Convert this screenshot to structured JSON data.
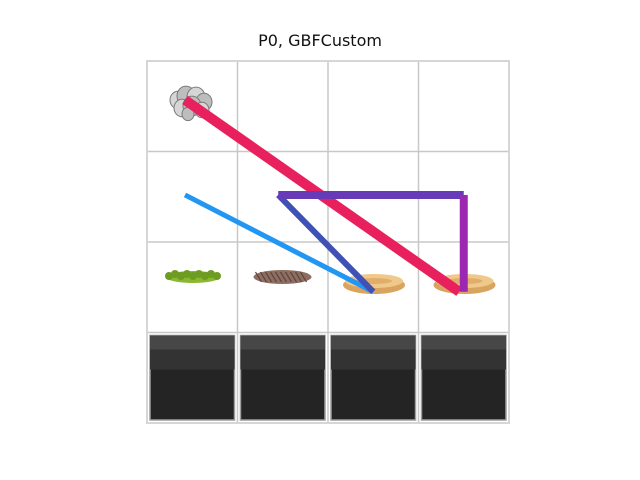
{
  "title": "P0, GBFCustom",
  "grid": {
    "rows": 4,
    "cols": 4,
    "line_color": "#c8c8c8",
    "border_color": "#d6d6d6"
  },
  "cells": [
    {
      "row": 0,
      "col": 0,
      "item": "lettuce"
    },
    {
      "row": 2,
      "col": 0,
      "item": "cucumber"
    },
    {
      "row": 2,
      "col": 1,
      "item": "patty"
    },
    {
      "row": 2,
      "col": 2,
      "item": "bun"
    },
    {
      "row": 2,
      "col": 3,
      "item": "bun"
    },
    {
      "row": 3,
      "col": 0,
      "item": "counter"
    },
    {
      "row": 3,
      "col": 1,
      "item": "counter"
    },
    {
      "row": 3,
      "col": 2,
      "item": "counter"
    },
    {
      "row": 3,
      "col": 3,
      "item": "counter"
    }
  ],
  "paths": [
    {
      "name": "path-red",
      "color": "#e8215e",
      "width": 10,
      "points": [
        [
          0.42,
          0.43
        ],
        [
          3.45,
          2.55
        ]
      ]
    },
    {
      "name": "path-blue",
      "color": "#2196f3",
      "width": 5,
      "points": [
        [
          0.42,
          1.48
        ],
        [
          2.5,
          2.55
        ]
      ]
    },
    {
      "name": "path-indigo",
      "color": "#3f51b5",
      "width": 6,
      "points": [
        [
          1.45,
          1.48
        ],
        [
          2.5,
          2.55
        ]
      ]
    },
    {
      "name": "path-deep-purple",
      "color": "#673ab7",
      "width": 8,
      "points": [
        [
          1.45,
          1.48
        ],
        [
          3.5,
          1.48
        ]
      ]
    },
    {
      "name": "path-purple",
      "color": "#9c27b0",
      "width": 8,
      "points": [
        [
          3.5,
          1.48
        ],
        [
          3.5,
          2.55
        ]
      ]
    }
  ]
}
